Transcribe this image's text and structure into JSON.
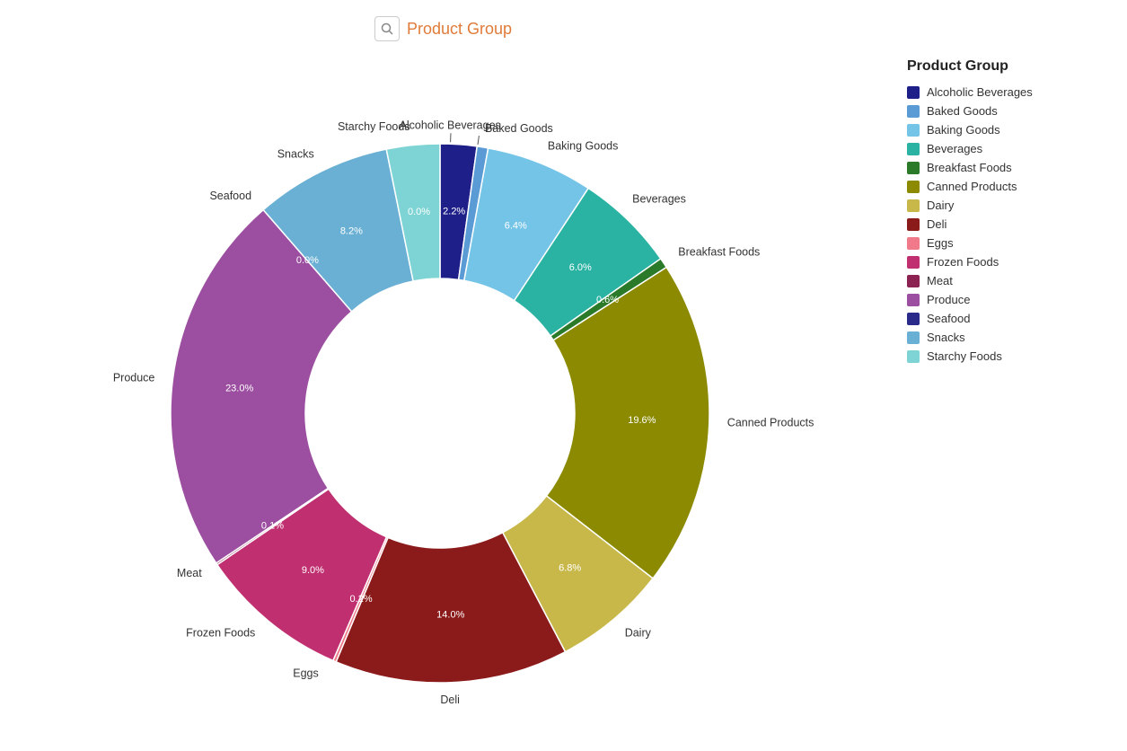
{
  "title": "Product Group",
  "title_icon": "Q",
  "segments": [
    {
      "label": "Alcoholic Beverages",
      "pct": 2.2,
      "color": "#1f1f8a",
      "startDeg": 0,
      "endDeg": 7.9
    },
    {
      "label": "Baked Goods",
      "pct": 0,
      "color": "#5b9bd5",
      "startDeg": 7.9,
      "endDeg": 10.3
    },
    {
      "label": "Baking Goods",
      "pct": 6.4,
      "color": "#74c4e8",
      "startDeg": 10.3,
      "endDeg": 33.4
    },
    {
      "label": "Beverages",
      "pct": 6.0,
      "color": "#2ab3a3",
      "startDeg": 33.4,
      "endDeg": 55.0
    },
    {
      "label": "Breakfast Foods",
      "pct": 0.6,
      "color": "#2a7a2a",
      "startDeg": 55.0,
      "endDeg": 57.2
    },
    {
      "label": "Canned Products",
      "pct": 19.6,
      "color": "#8b8a00",
      "startDeg": 57.2,
      "endDeg": 127.8
    },
    {
      "label": "Dairy",
      "pct": 6.8,
      "color": "#c8b84a",
      "startDeg": 127.8,
      "endDeg": 152.3
    },
    {
      "label": "Deli",
      "pct": 14.0,
      "color": "#8b1a1a",
      "startDeg": 152.3,
      "endDeg": 202.7
    },
    {
      "label": "Eggs",
      "pct": 0.2,
      "color": "#f07a8a",
      "startDeg": 202.7,
      "endDeg": 203.4
    },
    {
      "label": "Frozen Foods",
      "pct": 9.0,
      "color": "#c03070",
      "startDeg": 203.4,
      "endDeg": 235.8
    },
    {
      "label": "Meat",
      "pct": 0.1,
      "color": "#8b2252",
      "startDeg": 235.8,
      "endDeg": 236.2
    },
    {
      "label": "Produce",
      "pct": 23.0,
      "color": "#9c4fa0",
      "startDeg": 236.2,
      "endDeg": 319.0
    },
    {
      "label": "Seafood",
      "pct": 0.0,
      "color": "#2a2a8b",
      "startDeg": 319.0,
      "endDeg": 319.0
    },
    {
      "label": "Snacks",
      "pct": 8.2,
      "color": "#6ab0d4",
      "startDeg": 319.0,
      "endDeg": 348.5
    },
    {
      "label": "Starchy Foods",
      "pct": 0.0,
      "color": "#7ed4d4",
      "startDeg": 348.5,
      "endDeg": 360.0
    }
  ],
  "legend": {
    "title": "Product Group",
    "items": [
      {
        "label": "Alcoholic Beverages",
        "color": "#1f1f8a"
      },
      {
        "label": "Baked Goods",
        "color": "#5b9bd5"
      },
      {
        "label": "Baking Goods",
        "color": "#74c4e8"
      },
      {
        "label": "Beverages",
        "color": "#2ab3a3"
      },
      {
        "label": "Breakfast Foods",
        "color": "#2a7a2a"
      },
      {
        "label": "Canned Products",
        "color": "#8b8a00"
      },
      {
        "label": "Dairy",
        "color": "#c8b84a"
      },
      {
        "label": "Deli",
        "color": "#8b1a1a"
      },
      {
        "label": "Eggs",
        "color": "#f07a8a"
      },
      {
        "label": "Frozen Foods",
        "color": "#c03070"
      },
      {
        "label": "Meat",
        "color": "#8b2252"
      },
      {
        "label": "Produce",
        "color": "#9c4fa0"
      },
      {
        "label": "Seafood",
        "color": "#2a2a8b"
      },
      {
        "label": "Snacks",
        "color": "#6ab0d4"
      },
      {
        "label": "Starchy Foods",
        "color": "#7ed4d4"
      }
    ]
  },
  "outer_labels": [
    {
      "label": "Alcoholic Beverages",
      "angle": 4,
      "r": 290
    },
    {
      "label": "Baked Goods",
      "angle": 9,
      "r": 290
    },
    {
      "label": "Baking Goods",
      "angle": 22,
      "r": 290
    },
    {
      "label": "Beverages",
      "angle": 44,
      "r": 290
    },
    {
      "label": "Breakfast Foods",
      "angle": 56,
      "r": 290
    },
    {
      "label": "Canned Products",
      "angle": 92,
      "r": 290
    },
    {
      "label": "Dairy",
      "angle": 140,
      "r": 290
    },
    {
      "label": "Deli",
      "angle": 177,
      "r": 290
    },
    {
      "label": "Eggs",
      "angle": 203,
      "r": 290
    },
    {
      "label": "Frozen Foods",
      "angle": 219,
      "r": 290
    },
    {
      "label": "Meat",
      "angle": 236,
      "r": 290
    },
    {
      "label": "Produce",
      "angle": 277,
      "r": 290
    },
    {
      "label": "Seafood",
      "angle": 319,
      "r": 290
    },
    {
      "label": "Snacks",
      "angle": 334,
      "r": 290
    },
    {
      "label": "Starchy Foods",
      "angle": 354,
      "r": 290
    }
  ]
}
